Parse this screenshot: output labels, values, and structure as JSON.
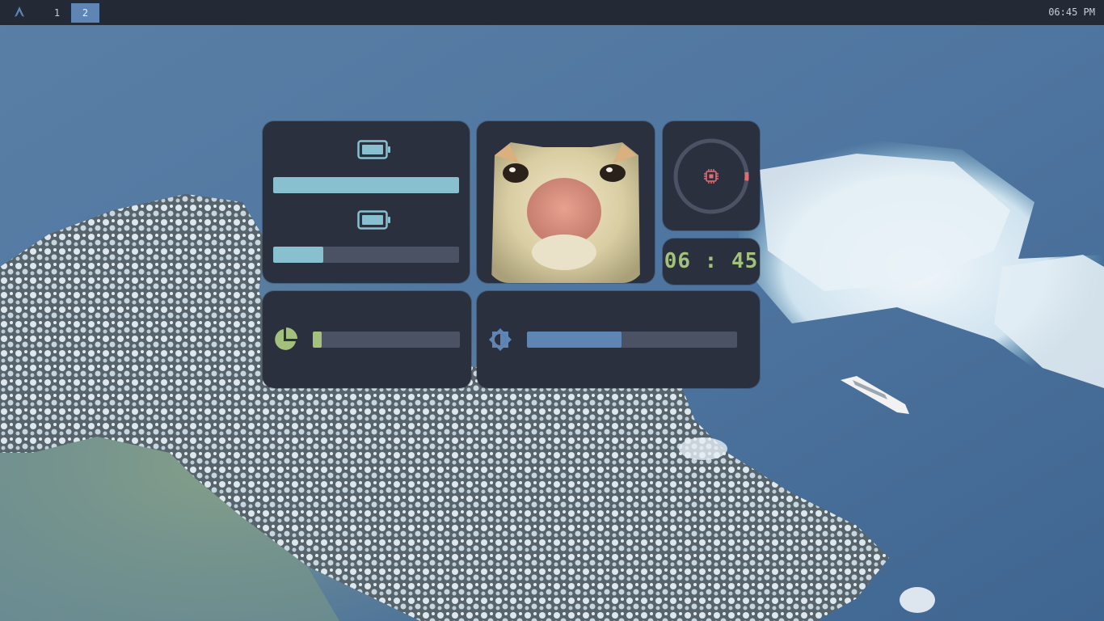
{
  "topbar": {
    "launcher_icon": "arch-logo-icon",
    "workspaces": [
      {
        "label": "1",
        "active": false
      },
      {
        "label": "2",
        "active": true
      }
    ],
    "clock": "06:45 PM"
  },
  "widgets": {
    "battery": {
      "icon": "battery-icon",
      "level_1": 1.0,
      "level_2": 0.27,
      "fill_color": "#89c0d0"
    },
    "profile": {
      "image": "cat-face-photo"
    },
    "cpu": {
      "icon": "cpu-chip-icon",
      "usage": 0.04,
      "ring_color": "#e06c75",
      "track_color": "#4b5264"
    },
    "time": {
      "text": "06 : 45",
      "color": "#a3c17c"
    },
    "disk": {
      "icon": "pie-chart-icon",
      "usage": 0.06,
      "fill_color": "#a3c17c"
    },
    "brightness": {
      "icon": "brightness-icon",
      "level": 0.45,
      "fill_color": "#5f85b4"
    }
  },
  "colors": {
    "bar_bg": "#232a36",
    "card_bg": "#2b303e",
    "active_ws": "#5f85b4"
  }
}
